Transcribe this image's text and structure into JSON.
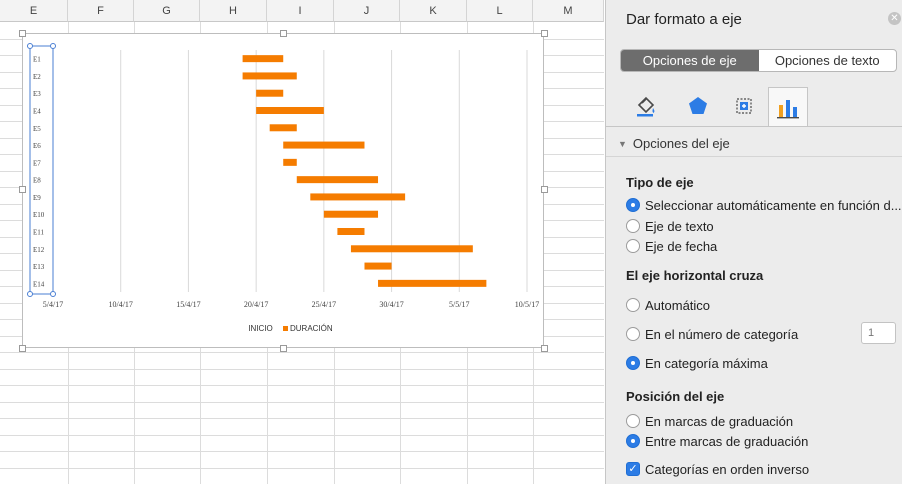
{
  "sheet": {
    "columns": [
      "E",
      "F",
      "G",
      "H",
      "I",
      "J",
      "K",
      "L",
      "M"
    ]
  },
  "chart_data": {
    "type": "bar",
    "orientation": "horizontal-stacked-gantt",
    "categories": [
      "E1",
      "E2",
      "E3",
      "E4",
      "E5",
      "E6",
      "E7",
      "E8",
      "E9",
      "E10",
      "E11",
      "E12",
      "E13",
      "E14"
    ],
    "series": [
      {
        "name": "INICIO",
        "color": "transparent",
        "start_dates": [
          "2017-04-19",
          "2017-04-19",
          "2017-04-20",
          "2017-04-20",
          "2017-04-21",
          "2017-04-22",
          "2017-04-22",
          "2017-04-23",
          "2017-04-24",
          "2017-04-25",
          "2017-04-26",
          "2017-04-27",
          "2017-04-28",
          "2017-04-29"
        ]
      },
      {
        "name": "DURACIÓN",
        "color": "#f57c00",
        "values": [
          3,
          4,
          2,
          5,
          2,
          6,
          1,
          6,
          7,
          4,
          2,
          9,
          2,
          8
        ]
      }
    ],
    "x_tick_labels": [
      "5/4/17",
      "10/4/17",
      "15/4/17",
      "20/4/17",
      "25/4/17",
      "30/4/17",
      "5/5/17",
      "10/5/17"
    ],
    "xlim": [
      "2017-04-05",
      "2017-05-10"
    ],
    "grid": true,
    "legend": "bottom",
    "reverse_categories": true
  },
  "panel": {
    "title": "Dar formato a eje",
    "close_icon": "close-icon",
    "tabs": [
      "Opciones de eje",
      "Opciones de texto"
    ],
    "icon_tabs": [
      "fill-bucket-icon",
      "pentagon-effects-icon",
      "size-properties-icon",
      "bar-chart-icon"
    ],
    "section": "Opciones del eje",
    "axis_type": {
      "heading": "Tipo de eje",
      "options": [
        "Seleccionar automáticamente en función d...",
        "Eje de texto",
        "Eje de fecha"
      ],
      "selected": 0
    },
    "crosses": {
      "heading": "El eje horizontal cruza",
      "options": [
        "Automático",
        "En el número de categoría",
        "En categoría máxima"
      ],
      "selected": 2,
      "category_placeholder": "1"
    },
    "position": {
      "heading": "Posición del eje",
      "options": [
        "En marcas de graduación",
        "Entre marcas de graduación"
      ],
      "selected": 1,
      "reverse_label": "Categorías en orden inverso",
      "reverse_checked": true
    },
    "accent": "#2c7ce5"
  }
}
